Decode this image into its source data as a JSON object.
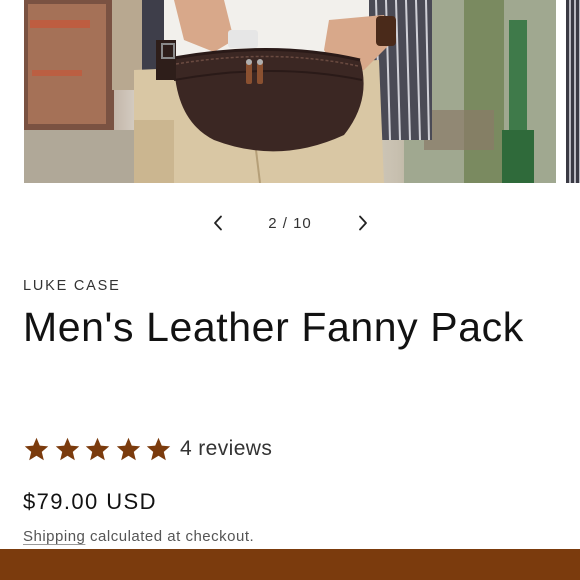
{
  "gallery": {
    "current": "2",
    "total": "10",
    "counter_text": "2 / 10",
    "prev_label": "Previous slide",
    "next_label": "Next slide",
    "image_alt": "Man wearing a dark brown leather fanny pack around the waist"
  },
  "product": {
    "vendor": "LUKE CASE",
    "title": "Men's Leather Fanny Pack",
    "rating": 5,
    "rating_max": 5,
    "reviews_text": "4 reviews",
    "price": "$79.00 USD",
    "shipping_link": "Shipping",
    "shipping_suffix": " calculated at checkout."
  },
  "colors": {
    "accent": "#7b3b0d",
    "text": "#121212",
    "muted": "#555555"
  },
  "icons": {
    "prev": "chevron-left-icon",
    "next": "chevron-right-icon",
    "star": "star-icon"
  }
}
